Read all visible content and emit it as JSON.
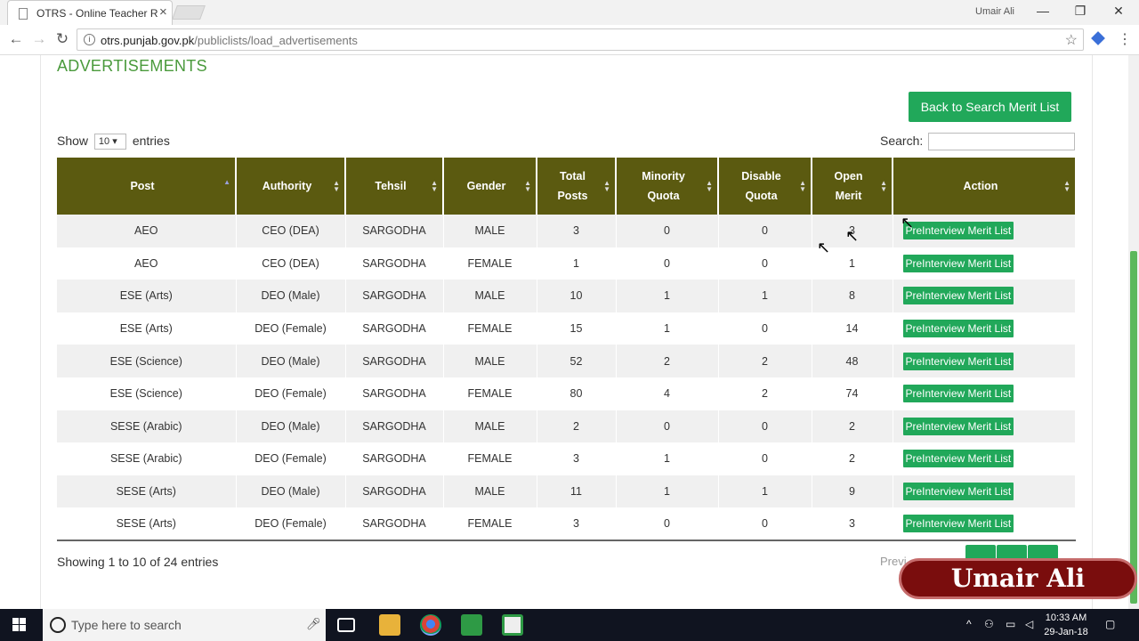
{
  "browser": {
    "tab_title": "OTRS - Online Teacher Re",
    "tab_close": "×",
    "user_name": "Umair Ali",
    "url_domain": "otrs.punjab.gov.pk",
    "url_path": "/publiclists/load_advertisements",
    "back_icon": "←",
    "forward_icon": "→",
    "reload_icon": "↻",
    "star_icon": "☆",
    "menu_icon": "⋮",
    "min_icon": "—",
    "max_icon": "❐",
    "close_icon": "✕"
  },
  "page": {
    "title": "ADVERTISEMENTS",
    "back_button": "Back to Search Merit List",
    "show_label": "Show",
    "entries_label": "entries",
    "page_length": "10 ▾",
    "search_label": "Search:",
    "search_value": "",
    "info": "Showing 1 to 10 of 24 entries",
    "prev_label": "Previ"
  },
  "table": {
    "headers": [
      {
        "line1": "Post",
        "line2": ""
      },
      {
        "line1": "Authority",
        "line2": ""
      },
      {
        "line1": "Tehsil",
        "line2": ""
      },
      {
        "line1": "Gender",
        "line2": ""
      },
      {
        "line1": "Total",
        "line2": "Posts"
      },
      {
        "line1": "Minority",
        "line2": "Quota"
      },
      {
        "line1": "Disable",
        "line2": "Quota"
      },
      {
        "line1": "Open",
        "line2": "Merit"
      },
      {
        "line1": "Action",
        "line2": ""
      }
    ],
    "action_label": "PreInterview Merit List",
    "rows": [
      {
        "post": "AEO",
        "authority": "CEO (DEA)",
        "tehsil": "SARGODHA",
        "gender": "MALE",
        "total": "3",
        "minority": "0",
        "disable": "0",
        "open": "3"
      },
      {
        "post": "AEO",
        "authority": "CEO (DEA)",
        "tehsil": "SARGODHA",
        "gender": "FEMALE",
        "total": "1",
        "minority": "0",
        "disable": "0",
        "open": "1"
      },
      {
        "post": "ESE (Arts)",
        "authority": "DEO (Male)",
        "tehsil": "SARGODHA",
        "gender": "MALE",
        "total": "10",
        "minority": "1",
        "disable": "1",
        "open": "8"
      },
      {
        "post": "ESE (Arts)",
        "authority": "DEO (Female)",
        "tehsil": "SARGODHA",
        "gender": "FEMALE",
        "total": "15",
        "minority": "1",
        "disable": "0",
        "open": "14"
      },
      {
        "post": "ESE (Science)",
        "authority": "DEO (Male)",
        "tehsil": "SARGODHA",
        "gender": "MALE",
        "total": "52",
        "minority": "2",
        "disable": "2",
        "open": "48"
      },
      {
        "post": "ESE (Science)",
        "authority": "DEO (Female)",
        "tehsil": "SARGODHA",
        "gender": "FEMALE",
        "total": "80",
        "minority": "4",
        "disable": "2",
        "open": "74"
      },
      {
        "post": "SESE (Arabic)",
        "authority": "DEO (Male)",
        "tehsil": "SARGODHA",
        "gender": "MALE",
        "total": "2",
        "minority": "0",
        "disable": "0",
        "open": "2"
      },
      {
        "post": "SESE (Arabic)",
        "authority": "DEO (Female)",
        "tehsil": "SARGODHA",
        "gender": "FEMALE",
        "total": "3",
        "minority": "1",
        "disable": "0",
        "open": "2"
      },
      {
        "post": "SESE (Arts)",
        "authority": "DEO (Male)",
        "tehsil": "SARGODHA",
        "gender": "MALE",
        "total": "11",
        "minority": "1",
        "disable": "1",
        "open": "9"
      },
      {
        "post": "SESE (Arts)",
        "authority": "DEO (Female)",
        "tehsil": "SARGODHA",
        "gender": "FEMALE",
        "total": "3",
        "minority": "0",
        "disable": "0",
        "open": "3"
      }
    ]
  },
  "watermark": "Umair Ali",
  "taskbar": {
    "search_placeholder": "Type here to search",
    "time": "10:33 AM",
    "date": "29-Jan-18"
  },
  "colors": {
    "header_bg": "#5b5a10",
    "accent_green": "#21a85a",
    "title_green": "#4a9a3c"
  }
}
